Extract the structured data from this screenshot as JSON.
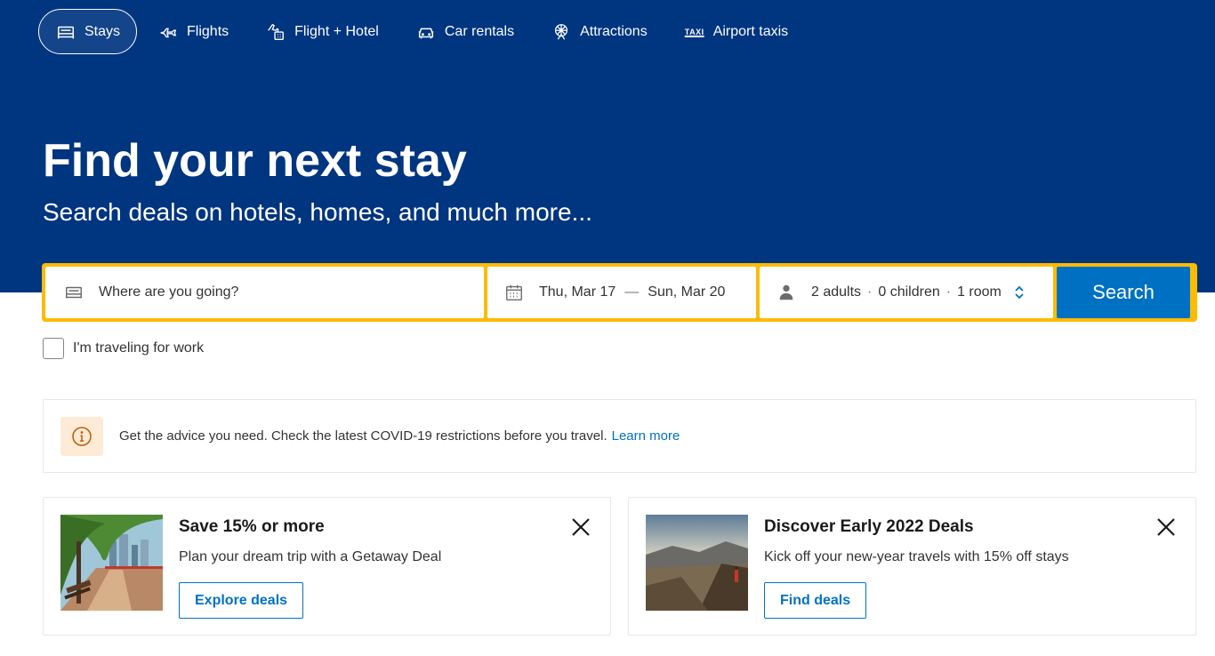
{
  "nav": {
    "items": [
      {
        "label": "Stays",
        "icon": "bed-icon"
      },
      {
        "label": "Flights",
        "icon": "plane-icon"
      },
      {
        "label": "Flight + Hotel",
        "icon": "flight-hotel-icon"
      },
      {
        "label": "Car rentals",
        "icon": "car-icon"
      },
      {
        "label": "Attractions",
        "icon": "ferris-wheel-icon"
      },
      {
        "label": "Airport taxis",
        "icon": "taxi-icon",
        "icon_text": "TAXI"
      }
    ]
  },
  "hero": {
    "title": "Find your next stay",
    "subtitle": "Search deals on hotels, homes, and much more..."
  },
  "search": {
    "destination_placeholder": "Where are you going?",
    "checkin": "Thu, Mar 17",
    "date_separator": "—",
    "checkout": "Sun, Mar 20",
    "adults": "2 adults",
    "children": "0 children",
    "rooms": "1 room",
    "occ_separator": "·",
    "button_label": "Search"
  },
  "work_travel": {
    "label": "I'm traveling for work",
    "checked": false
  },
  "covid": {
    "message": "Get the advice you need. Check the latest COVID-19 restrictions before you travel.",
    "link": "Learn more"
  },
  "promos": [
    {
      "title": "Save 15% or more",
      "description": "Plan your dream trip with a Getaway Deal",
      "button": "Explore deals"
    },
    {
      "title": "Discover Early 2022 Deals",
      "description": "Kick off your new-year travels with 15% off stays",
      "button": "Find deals"
    }
  ],
  "colors": {
    "brand_blue": "#003580",
    "accent_yellow": "#febb02",
    "action_blue": "#0071c2",
    "info_bg": "#fdebd7",
    "info_icon": "#c05a00"
  }
}
